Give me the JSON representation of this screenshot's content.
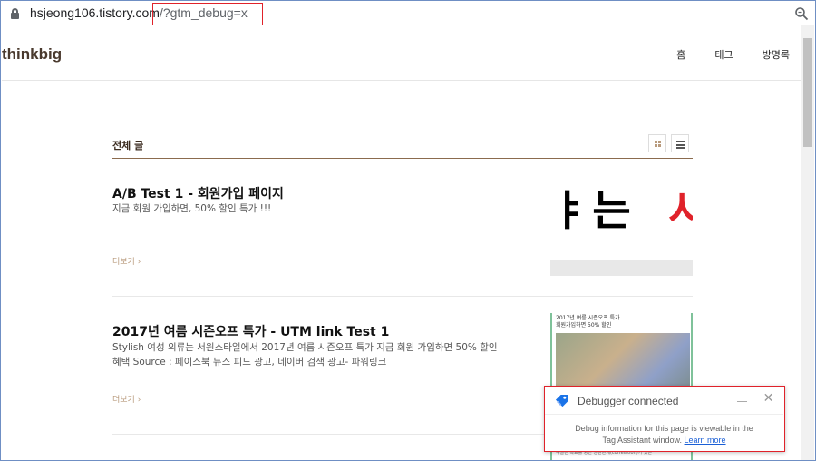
{
  "address_bar": {
    "url_host": "hsjeong106.tistory.com",
    "url_path": "/?gtm_debug=x"
  },
  "blog": {
    "logo": "thinkbig",
    "nav": [
      "홈",
      "태그",
      "방명록"
    ],
    "section_title": "전체 글"
  },
  "posts": [
    {
      "title": "A/B Test 1 - 회원가입 페이지",
      "desc": "지금 회원 가입하면, 50% 할인 특가 !!!",
      "more": "더보기 ›",
      "thumb_text": "ㅑ는",
      "thumb_text_red": "시"
    },
    {
      "title": "2017년 여름 시즌오프 특가 - UTM link Test 1",
      "desc": "Stylish 여성 의류는 서원스타일에서 2017년 여름 시즌오프 특가 지금 회원 가입하면 50% 할인 혜택 Source : 페이스북 뉴스 피드 광고, 네이버 검색 광고- 파워링크",
      "more": "더보기 ›",
      "thumb_line1": "2017년 여름 시즌오프 특가",
      "thumb_line2": "회원가입하면 50% 할인",
      "thumb_footer": "구글은 목표를 향한 상관관계(correlation)가 있는"
    }
  ],
  "debugger": {
    "title": "Debugger connected",
    "body_line1": "Debug information for this page is viewable in the",
    "body_line2": "Tag Assistant window.",
    "link": "Learn more",
    "icon": "tag-assistant-icon"
  },
  "colors": {
    "highlight": "#e0222a",
    "accent_brown": "#8b6b4e",
    "link_blue": "#1a5fd6"
  }
}
